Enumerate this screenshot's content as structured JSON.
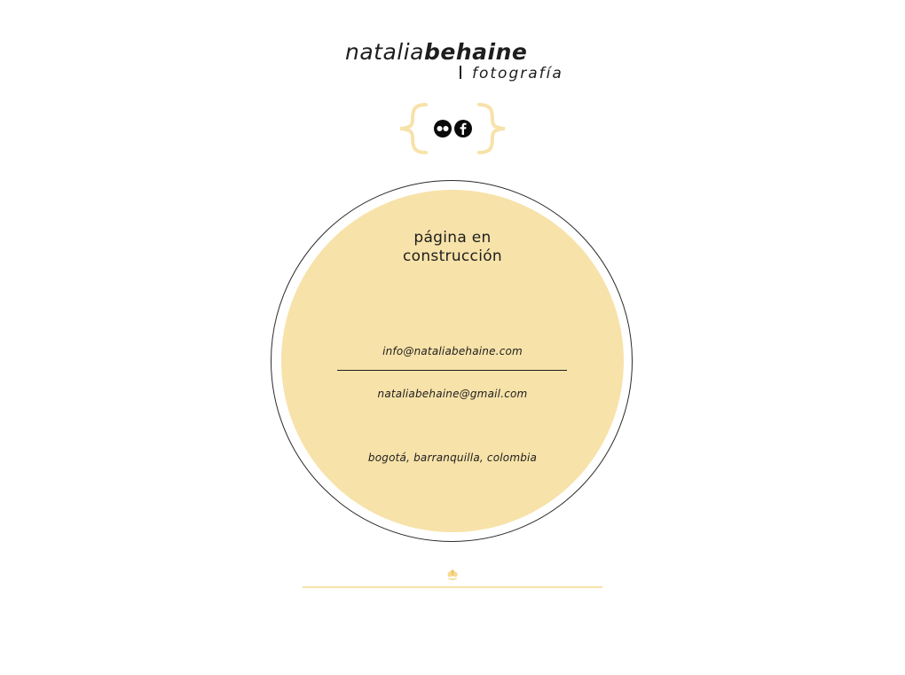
{
  "header": {
    "logo_light": "natalia",
    "logo_bold": "behaine",
    "logo_subtitle": "fotografía"
  },
  "social": {
    "icons": [
      "flickr-icon",
      "facebook-icon"
    ]
  },
  "main": {
    "construction_line1": "página en",
    "construction_line2": "construcción",
    "email_primary": "info@nataliabehaine.com",
    "email_secondary": "nataliabehaine@gmail.com",
    "location": "bogotá, barranquilla, colombia"
  },
  "footer": {
    "emblem_icon": "flower-emblem-icon"
  },
  "colors": {
    "accent": "#f7e2a9",
    "text": "#1e1e1e",
    "circle_outline": "#2a2a2a",
    "background": "#ffffff"
  }
}
